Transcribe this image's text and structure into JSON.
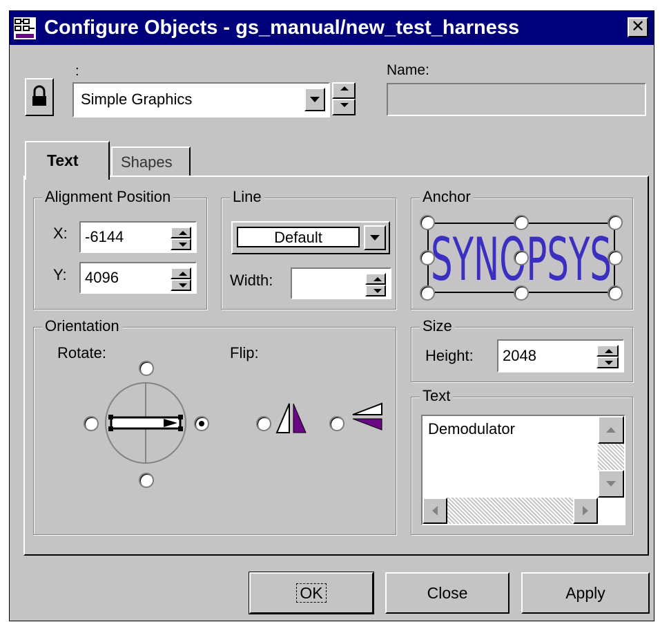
{
  "window": {
    "title": "Configure Objects - gs_manual/new_test_harness",
    "close_glyph": "✕"
  },
  "top": {
    "colon_label": ":",
    "object_type_value": "Simple Graphics",
    "name_label": "Name:",
    "name_value": ""
  },
  "tabs": [
    {
      "label": "Text",
      "active": true
    },
    {
      "label": "Shapes",
      "active": false
    }
  ],
  "alignment": {
    "title": "Alignment Position",
    "x_label": "X:",
    "x_value": "-6144",
    "y_label": "Y:",
    "y_value": "4096"
  },
  "line": {
    "title": "Line",
    "style_value": "Default",
    "width_label": "Width:",
    "width_value": ""
  },
  "anchor": {
    "title": "Anchor",
    "logo_text": "SYNOPSYS"
  },
  "orientation": {
    "title": "Orientation",
    "rotate_label": "Rotate:",
    "flip_label": "Flip:"
  },
  "size": {
    "title": "Size",
    "height_label": "Height:",
    "height_value": "2048"
  },
  "text_group": {
    "title": "Text",
    "content": "Demodulator"
  },
  "buttons": {
    "ok": "OK",
    "close": "Close",
    "apply": "Apply"
  },
  "colors": {
    "titlebar": "#00007b",
    "face": "#c6c3c6",
    "accent_purple": "#6b0884",
    "logo_blue": "#3a2fc0"
  }
}
